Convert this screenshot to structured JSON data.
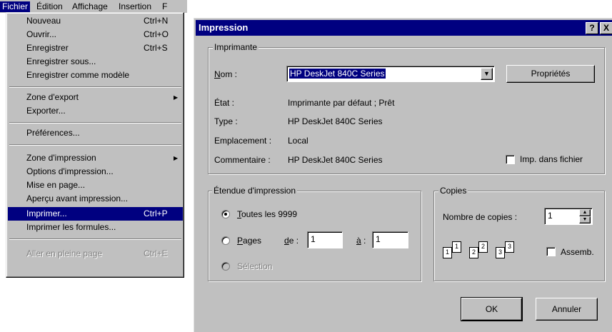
{
  "menubar": {
    "items": [
      "Fichier",
      "Édition",
      "Affichage",
      "Insertion",
      "F"
    ]
  },
  "file_menu": {
    "items": [
      {
        "label": "Nouveau",
        "shortcut": "Ctrl+N"
      },
      {
        "label": "Ouvrir...",
        "shortcut": "Ctrl+O"
      },
      {
        "label": "Enregistrer",
        "shortcut": "Ctrl+S"
      },
      {
        "label": "Enregistrer sous...",
        "shortcut": ""
      },
      {
        "label": "Enregistrer comme modèle",
        "shortcut": ""
      },
      {
        "label": "Zone d'export",
        "shortcut": ""
      },
      {
        "label": "Exporter...",
        "shortcut": ""
      },
      {
        "label": "Préférences...",
        "shortcut": ""
      },
      {
        "label": "Zone d'impression",
        "shortcut": ""
      },
      {
        "label": "Options d'impression...",
        "shortcut": ""
      },
      {
        "label": "Mise en page...",
        "shortcut": ""
      },
      {
        "label": "Aperçu avant impression...",
        "shortcut": ""
      },
      {
        "label": "Imprimer...",
        "shortcut": "Ctrl+P"
      },
      {
        "label": "Imprimer les formules...",
        "shortcut": ""
      },
      {
        "label": "Aller en pleine page",
        "shortcut": "Ctrl+E"
      }
    ]
  },
  "dialog": {
    "title": "Impression",
    "help_button": "?",
    "close_button": "X",
    "printer": {
      "group_label": "Imprimante",
      "name_label": "Nom :",
      "name_value": "HP DeskJet 840C Series",
      "properties_button": "Propriétés",
      "status_label": "État :",
      "status_value": "Imprimante par défaut ; Prêt",
      "type_label": "Type :",
      "type_value": "HP DeskJet 840C Series",
      "location_label": "Emplacement :",
      "location_value": "Local",
      "comment_label": "Commentaire :",
      "comment_value": "HP DeskJet 840C Series",
      "print_to_file_label": "Imp. dans fichier"
    },
    "range": {
      "group_label": "Étendue d'impression",
      "all_label": "Toutes les 9999",
      "pages_label": "Pages",
      "from_label": "de :",
      "from_value": "1",
      "to_label": "à :",
      "to_value": "1",
      "selection_label": "Sélection"
    },
    "copies": {
      "group_label": "Copies",
      "count_label": "Nombre de copies :",
      "count_value": "1",
      "collate_label": "Assemb.",
      "page_icons": [
        "1",
        "1",
        "2",
        "2",
        "3",
        "3"
      ]
    },
    "ok_button": "OK",
    "cancel_button": "Annuler"
  },
  "colors": {
    "window_face": "#c0c0c0",
    "title_bar": "#000080",
    "highlight": "#000080"
  }
}
